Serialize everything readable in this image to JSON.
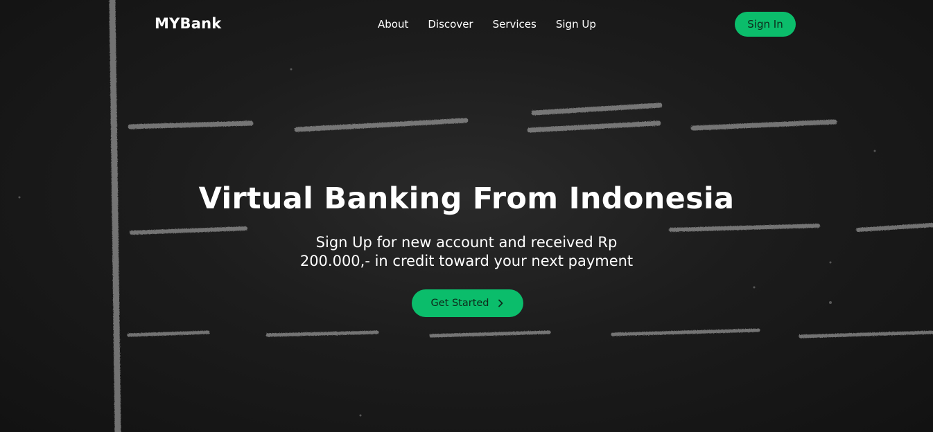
{
  "navbar": {
    "brand": "MYBank",
    "links": [
      "About",
      "Discover",
      "Services",
      "Sign Up"
    ],
    "signin_label": "Sign In"
  },
  "hero": {
    "title": "Virtual Banking From Indonesia",
    "subtitle_line1": "Sign Up for new account and received Rp",
    "subtitle_line2": "200.000,- in credit toward your next payment",
    "cta_label": "Get Started",
    "cta_icon": "chevron-right-icon"
  },
  "colors": {
    "accent": "#0bbd6b",
    "background": "#1c1c1c",
    "text": "#ffffff"
  }
}
